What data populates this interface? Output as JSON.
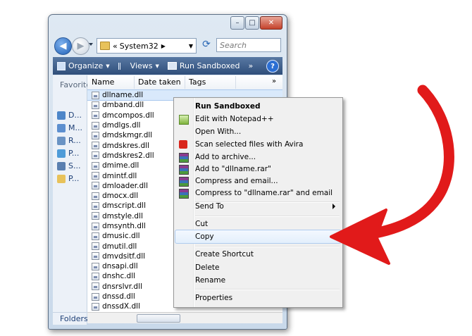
{
  "window": {
    "minimize": "–",
    "maximize": "□",
    "close": "✕"
  },
  "nav": {
    "back": "◀",
    "forward": "▶",
    "breadcrumb_prefix": "«",
    "current_folder": "System32",
    "search_placeholder": "Search"
  },
  "toolbar": {
    "organize": "Organize",
    "views": "Views",
    "run_sandboxed": "Run Sandboxed",
    "more": "»",
    "help": "?"
  },
  "sidebar": {
    "header": "Favorite",
    "items": [
      "D...",
      "M...",
      "R...",
      "P...",
      "S...",
      "P..."
    ],
    "folders": "Folders"
  },
  "columns": [
    "Name",
    "Date taken",
    "Tags"
  ],
  "files": [
    "dllname.dll",
    "dmband.dll",
    "dmcompos.dll",
    "dmdlgs.dll",
    "dmdskmgr.dll",
    "dmdskres.dll",
    "dmdskres2.dll",
    "dmime.dll",
    "dmintf.dll",
    "dmloader.dll",
    "dmocx.dll",
    "dmscript.dll",
    "dmstyle.dll",
    "dmsynth.dll",
    "dmusic.dll",
    "dmutil.dll",
    "dmvdsitf.dll",
    "dnsapi.dll",
    "dnshc.dll",
    "dnsrslvr.dll",
    "dnssd.dll",
    "dnssdX.dll"
  ],
  "context_menu": {
    "run_sandboxed": "Run Sandboxed",
    "edit_notepad": "Edit with Notepad++",
    "open_with": "Open With...",
    "scan_avira": "Scan selected files with Avira",
    "add_archive": "Add to archive...",
    "add_rar": "Add to \"dllname.rar\"",
    "compress_email": "Compress and email...",
    "compress_rar_email": "Compress to \"dllname.rar\" and email",
    "send_to": "Send To",
    "cut": "Cut",
    "copy": "Copy",
    "create_shortcut": "Create Shortcut",
    "delete": "Delete",
    "rename": "Rename",
    "properties": "Properties"
  },
  "colors": {
    "arrow": "#e11a1a",
    "toolbar": "#3d5d89",
    "hover": "#e3effc"
  },
  "icons": {
    "organize": "organize-icon",
    "views": "views-icon",
    "run_sandboxed": "sandbox-icon",
    "notepad": "notepad-icon",
    "avira": "avira-icon",
    "winrar": "winrar-icon",
    "folder": "folder-icon",
    "dll": "dll-file-icon"
  }
}
